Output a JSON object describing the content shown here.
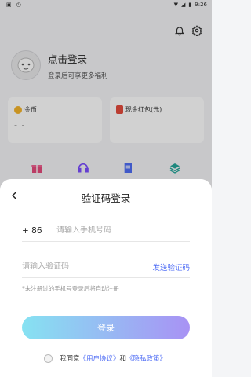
{
  "status_bar": {
    "time": "9:26",
    "wifi_icon": "wifi-icon",
    "signal_icon": "signal-icon",
    "battery_icon": "battery-icon"
  },
  "header": {
    "bell_icon": "bell-icon",
    "settings_icon": "gear-icon"
  },
  "profile": {
    "title": "点击登录",
    "subtitle": "登录后可享更多福利"
  },
  "cards": [
    {
      "label": "金币",
      "value": "- -"
    },
    {
      "label": "现金红包(元)",
      "value": ""
    }
  ],
  "login_sheet": {
    "title": "验证码登录",
    "country_code": "+ 86",
    "phone_placeholder": "请输入手机号码",
    "code_placeholder": "请输入验证码",
    "send_code": "发送验证码",
    "hint": "*未注册过的手机号登录后将自动注册",
    "login_button": "登录",
    "agree_prefix": "我同意",
    "user_agreement": "《用户协议》",
    "and": "和",
    "privacy_policy": "《隐私政策》"
  },
  "colors": {
    "accent": "#4f6df5",
    "button_start": "#86e2f2",
    "button_end": "#a892f4"
  }
}
